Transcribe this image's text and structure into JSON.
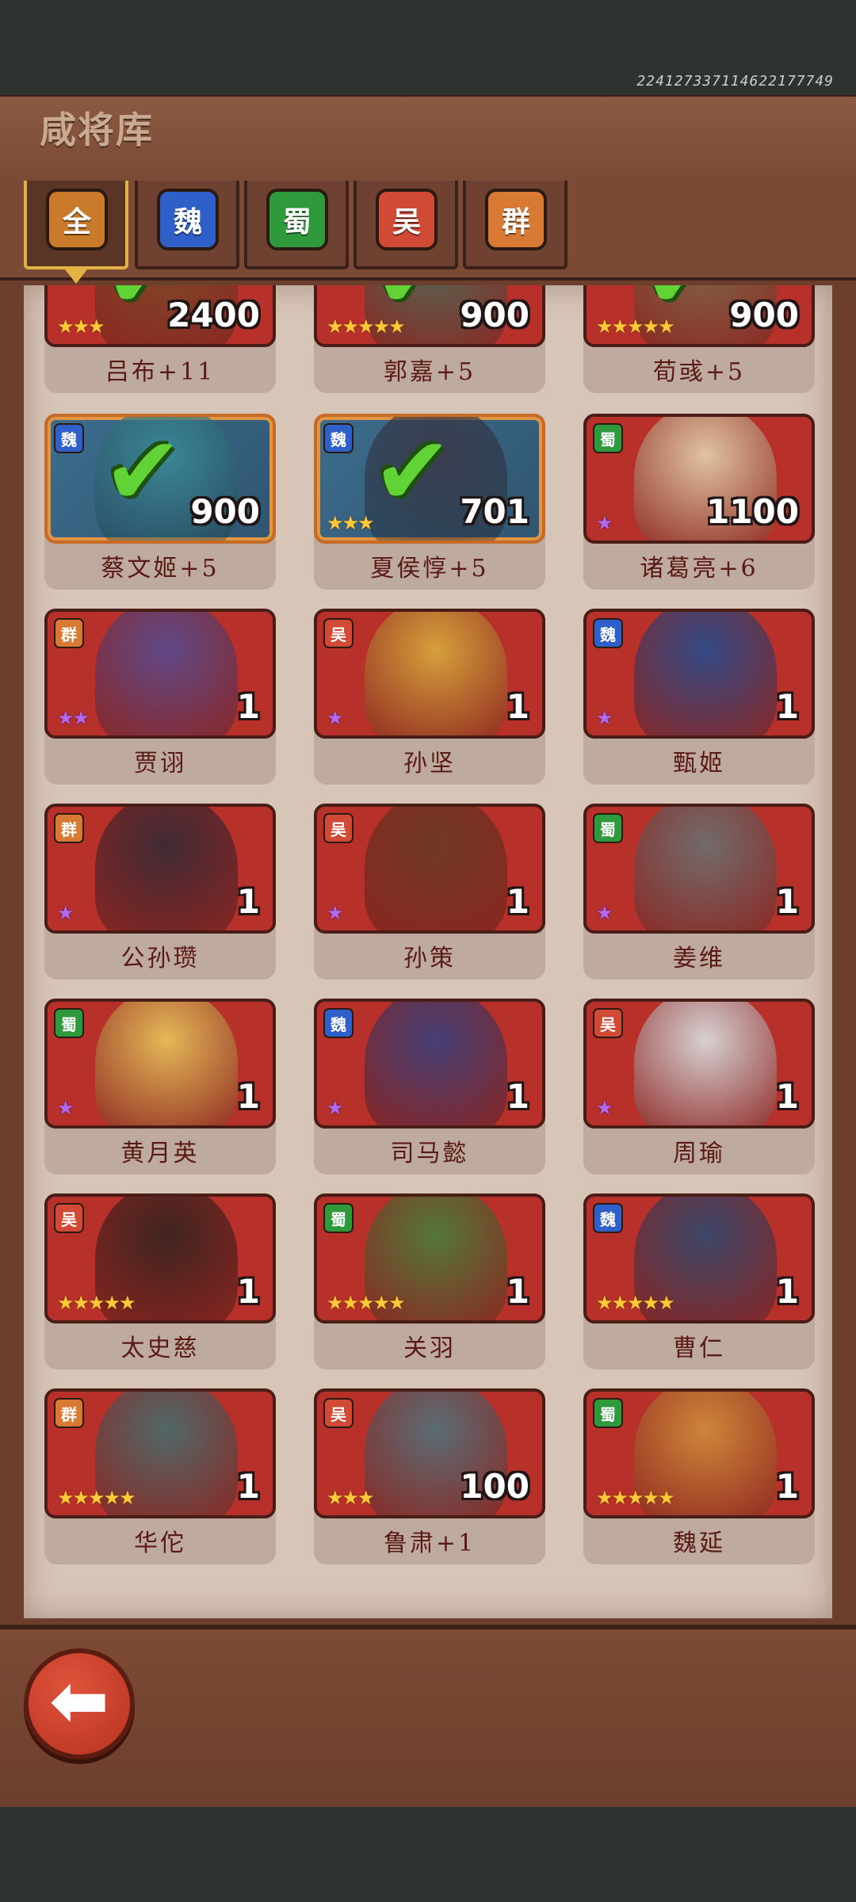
{
  "header": {
    "title": "咸将库",
    "uid": "224127337114622177749"
  },
  "tabs": [
    {
      "label": "全",
      "color": "#c97a2a",
      "active": true
    },
    {
      "label": "魏",
      "color": "#2f5fc8",
      "active": false
    },
    {
      "label": "蜀",
      "color": "#2f9a3c",
      "active": false
    },
    {
      "label": "吴",
      "color": "#d04a35",
      "active": false
    },
    {
      "label": "群",
      "color": "#d97a34",
      "active": false
    }
  ],
  "heroes": [
    {
      "name": "吕布+11",
      "count": "2400",
      "faction": "",
      "stars": 3,
      "star_color": "gold",
      "checked": true,
      "frame": "red",
      "art": "#7b4a2a"
    },
    {
      "name": "郭嘉+5",
      "count": "900",
      "faction": "",
      "stars": 5,
      "star_color": "gold",
      "checked": true,
      "frame": "red",
      "art": "#4e6a57"
    },
    {
      "name": "荀彧+5",
      "count": "900",
      "faction": "",
      "stars": 5,
      "star_color": "gold",
      "checked": true,
      "frame": "red",
      "art": "#7c6a4a"
    },
    {
      "name": "蔡文姬+5",
      "count": "900",
      "faction": "魏",
      "stars": 0,
      "star_color": "gold",
      "checked": true,
      "frame": "gold",
      "art": "#3a8896"
    },
    {
      "name": "夏侯惇+5",
      "count": "701",
      "faction": "魏",
      "stars": 3,
      "star_color": "gold",
      "checked": true,
      "frame": "gold",
      "art": "#3c3b4c"
    },
    {
      "name": "诸葛亮+6",
      "count": "1100",
      "faction": "蜀",
      "stars": 1,
      "star_color": "purple",
      "checked": false,
      "frame": "red",
      "art": "#e1cba6"
    },
    {
      "name": "贾诩",
      "count": "1",
      "faction": "群",
      "stars": 2,
      "star_color": "purple",
      "checked": false,
      "frame": "red",
      "art": "#5b4a8c"
    },
    {
      "name": "孙坚",
      "count": "1",
      "faction": "吴",
      "stars": 1,
      "star_color": "purple",
      "checked": false,
      "frame": "red",
      "art": "#d8a53c"
    },
    {
      "name": "甄姬",
      "count": "1",
      "faction": "魏",
      "stars": 1,
      "star_color": "purple",
      "checked": false,
      "frame": "red",
      "art": "#2c4b8a"
    },
    {
      "name": "公孙瓒",
      "count": "1",
      "faction": "群",
      "stars": 1,
      "star_color": "purple",
      "checked": false,
      "frame": "red",
      "art": "#3a2a36"
    },
    {
      "name": "孙策",
      "count": "1",
      "faction": "吴",
      "stars": 1,
      "star_color": "purple",
      "checked": false,
      "frame": "red",
      "art": "#6b3a24"
    },
    {
      "name": "姜维",
      "count": "1",
      "faction": "蜀",
      "stars": 1,
      "star_color": "purple",
      "checked": false,
      "frame": "red",
      "art": "#6e6e6e"
    },
    {
      "name": "黄月英",
      "count": "1",
      "faction": "蜀",
      "stars": 1,
      "star_color": "purple",
      "checked": false,
      "frame": "red",
      "art": "#e7bf5a"
    },
    {
      "name": "司马懿",
      "count": "1",
      "faction": "魏",
      "stars": 1,
      "star_color": "purple",
      "checked": false,
      "frame": "red",
      "art": "#3f3f78"
    },
    {
      "name": "周瑜",
      "count": "1",
      "faction": "吴",
      "stars": 1,
      "star_color": "purple",
      "checked": false,
      "frame": "red",
      "art": "#d9d9dc"
    },
    {
      "name": "太史慈",
      "count": "1",
      "faction": "吴",
      "stars": 5,
      "star_color": "gold",
      "checked": false,
      "frame": "red",
      "art": "#3a2420"
    },
    {
      "name": "关羽",
      "count": "1",
      "faction": "蜀",
      "stars": 5,
      "star_color": "gold",
      "checked": false,
      "frame": "red",
      "art": "#4f7a3a"
    },
    {
      "name": "曹仁",
      "count": "1",
      "faction": "魏",
      "stars": 5,
      "star_color": "gold",
      "checked": false,
      "frame": "red",
      "art": "#35476b"
    },
    {
      "name": "华佗",
      "count": "1",
      "faction": "群",
      "stars": 5,
      "star_color": "gold",
      "checked": false,
      "frame": "red",
      "art": "#4c6a6b"
    },
    {
      "name": "鲁肃+1",
      "count": "100",
      "faction": "吴",
      "stars": 3,
      "star_color": "gold",
      "checked": false,
      "frame": "red",
      "art": "#566f78"
    },
    {
      "name": "魏延",
      "count": "1",
      "faction": "蜀",
      "stars": 5,
      "star_color": "gold",
      "checked": false,
      "frame": "red",
      "art": "#d08a3a"
    }
  ],
  "faction_colors": {
    "魏": "#2f5fc8",
    "蜀": "#2f9a3c",
    "吴": "#d04a35",
    "群": "#d97a34"
  },
  "back_button": {
    "icon": "back-arrow-icon",
    "glyph": "⬅"
  }
}
